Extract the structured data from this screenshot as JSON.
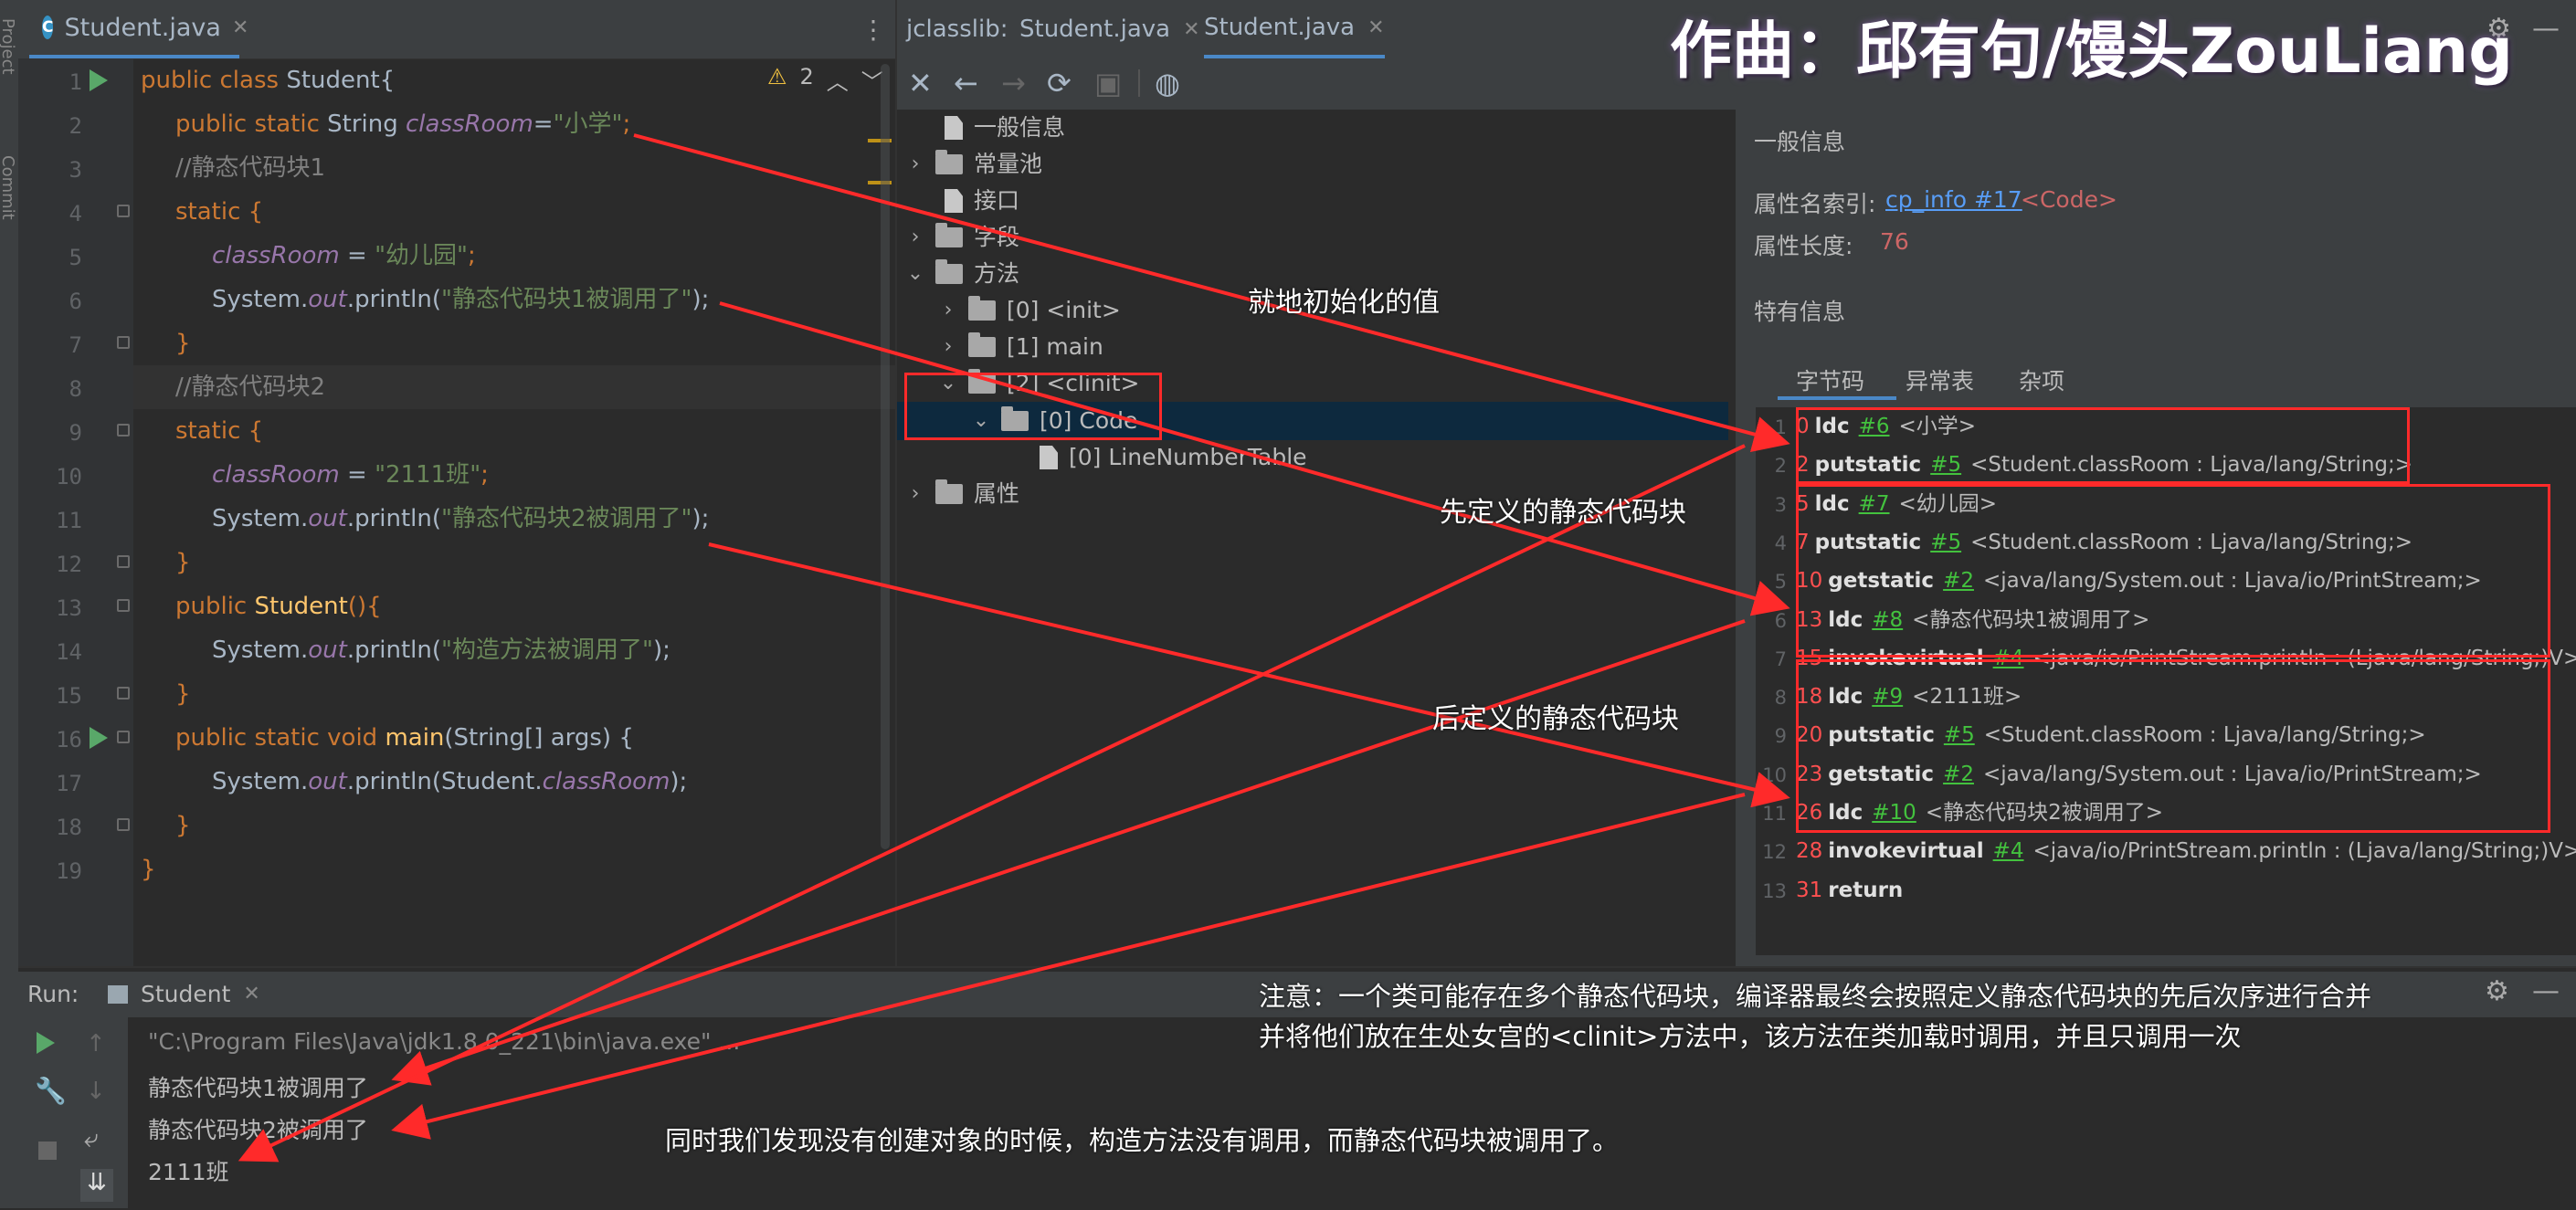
{
  "credit": "作曲：邱有句/馒头ZouLiang",
  "editor": {
    "tab_title": "Student.java",
    "warning_count": "2",
    "lines": [
      {
        "n": "1",
        "run": true
      },
      {
        "n": "2"
      },
      {
        "n": "3"
      },
      {
        "n": "4"
      },
      {
        "n": "5"
      },
      {
        "n": "6"
      },
      {
        "n": "7"
      },
      {
        "n": "8"
      },
      {
        "n": "9"
      },
      {
        "n": "10"
      },
      {
        "n": "11"
      },
      {
        "n": "12"
      },
      {
        "n": "13"
      },
      {
        "n": "14"
      },
      {
        "n": "15"
      },
      {
        "n": "16",
        "run": true
      },
      {
        "n": "17"
      },
      {
        "n": "18"
      },
      {
        "n": "19"
      }
    ],
    "code": {
      "l1_a": "public class ",
      "l1_b": "Student{",
      "l2_a": "public static ",
      "l2_b": "String ",
      "l2_c": "classRoom",
      "l2_d": "=",
      "l2_e": "\"小学\"",
      "l2_f": ";",
      "l3": "//静态代码块1",
      "l4_a": "static ",
      "l4_b": "{",
      "l5_a": "classRoom",
      "l5_b": " = ",
      "l5_c": "\"幼儿园\"",
      "l5_d": ";",
      "l6_a": "System.",
      "l6_b": "out",
      "l6_c": ".println(",
      "l6_d": "\"静态代码块1被调用了\"",
      "l6_e": ");",
      "l7": "}",
      "l8": "//静态代码块2",
      "l9_a": "static ",
      "l9_b": "{",
      "l10_a": "classRoom",
      "l10_b": " = ",
      "l10_c": "\"2111班\"",
      "l10_d": ";",
      "l11_a": "System.",
      "l11_b": "out",
      "l11_c": ".println(",
      "l11_d": "\"静态代码块2被调用了\"",
      "l11_e": ");",
      "l12": "}",
      "l13_a": "public ",
      "l13_b": "Student",
      "l13_c": "(){",
      "l14_a": "System.",
      "l14_b": "out",
      "l14_c": ".println(",
      "l14_d": "\"构造方法被调用了\"",
      "l14_e": ");",
      "l15": "}",
      "l16_a": "public static void ",
      "l16_b": "main",
      "l16_c": "(String[] args) {",
      "l17_a": "System.",
      "l17_b": "out",
      "l17_c": ".println(Student.",
      "l17_d": "classRoom",
      "l17_e": ");",
      "l18": "}",
      "l19": "}"
    }
  },
  "jclasslib": {
    "tab_label": "jclasslib:",
    "tab1": "Student.java",
    "tab2": "Student.java",
    "tree": {
      "general": "一般信息",
      "const_pool": "常量池",
      "interfaces": "接口",
      "fields": "字段",
      "methods": "方法",
      "m_init": "[0] <init>",
      "m_main": "[1] main",
      "m_clinit": "[2] <clinit>",
      "code": "[0] Code",
      "lnt": "[0] LineNumberTable",
      "attrs": "属性"
    },
    "detail": {
      "general_title": "一般信息",
      "attr_name_label": "属性名索引:",
      "attr_name_link": "cp_info #17",
      "attr_name_value": "<Code>",
      "attr_len_label": "属性长度:",
      "attr_len_value": "76",
      "specific_title": "特有信息",
      "subtabs": [
        "字节码",
        "异常表",
        "杂项"
      ]
    },
    "bytecode": [
      {
        "ln": "1",
        "off": "0",
        "op": "ldc",
        "ref": "#6",
        "arg": "<小学>"
      },
      {
        "ln": "2",
        "off": "2",
        "op": "putstatic",
        "ref": "#5",
        "arg": "<Student.classRoom : Ljava/lang/String;>"
      },
      {
        "ln": "3",
        "off": "5",
        "op": "ldc",
        "ref": "#7",
        "arg": "<幼儿园>"
      },
      {
        "ln": "4",
        "off": "7",
        "op": "putstatic",
        "ref": "#5",
        "arg": "<Student.classRoom : Ljava/lang/String;>"
      },
      {
        "ln": "5",
        "off": "10",
        "op": "getstatic",
        "ref": "#2",
        "arg": "<java/lang/System.out : Ljava/io/PrintStream;>"
      },
      {
        "ln": "6",
        "off": "13",
        "op": "ldc",
        "ref": "#8",
        "arg": "<静态代码块1被调用了>"
      },
      {
        "ln": "7",
        "off": "15",
        "op": "invokevirtual",
        "ref": "#4",
        "arg": "<java/io/PrintStream.println : (Ljava/lang/String;)V>"
      },
      {
        "ln": "8",
        "off": "18",
        "op": "ldc",
        "ref": "#9",
        "arg": "<2111班>"
      },
      {
        "ln": "9",
        "off": "20",
        "op": "putstatic",
        "ref": "#5",
        "arg": "<Student.classRoom : Ljava/lang/String;>"
      },
      {
        "ln": "10",
        "off": "23",
        "op": "getstatic",
        "ref": "#2",
        "arg": "<java/lang/System.out : Ljava/io/PrintStream;>"
      },
      {
        "ln": "11",
        "off": "26",
        "op": "ldc",
        "ref": "#10",
        "arg": "<静态代码块2被调用了>"
      },
      {
        "ln": "12",
        "off": "28",
        "op": "invokevirtual",
        "ref": "#4",
        "arg": "<java/io/PrintStream.println : (Ljava/lang/String;)V>"
      },
      {
        "ln": "13",
        "off": "31",
        "op": "return",
        "ref": "",
        "arg": ""
      }
    ]
  },
  "run": {
    "label": "Run:",
    "tab": "Student",
    "cmd": "\"C:\\Program Files\\Java\\jdk1.8.0_221\\bin\\java.exe\" ...",
    "out1": "静态代码块1被调用了",
    "out2": "静态代码块2被调用了",
    "out3": "2111班"
  },
  "annotations": {
    "a1": "就地初始化的值",
    "a2": "先定义的静态代码块",
    "a3": "后定义的静态代码块",
    "note1": "注意：一个类可能存在多个静态代码块，编译器最终会按照定义静态代码块的先后次序进行合并",
    "note2": "并将他们放在生处女宫的<clinit>方法中，该方法在类加载时调用，并且只调用一次",
    "note3": "同时我们发现没有创建对象的时候，构造方法没有调用，而静态代码块被调用了。"
  },
  "colors": {
    "accent": "#4a88c7",
    "annotation_red": "#ff2a2a",
    "ref_green": "#43c23e",
    "offset_red": "#ff5050"
  }
}
